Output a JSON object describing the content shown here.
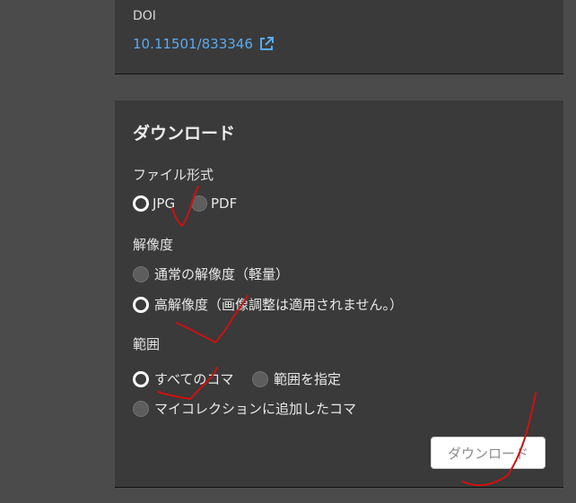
{
  "doi": {
    "label": "DOI",
    "value": "10.11501/833346",
    "link_icon": "external-link-icon"
  },
  "download": {
    "title": "ダウンロード",
    "file_format": {
      "label": "ファイル形式",
      "options": [
        "JPG",
        "PDF"
      ],
      "selected": "JPG"
    },
    "resolution": {
      "label": "解像度",
      "options": [
        "通常の解像度（軽量）",
        "高解像度（画像調整は適用されません。）"
      ],
      "selected": "高解像度（画像調整は適用されません。）"
    },
    "range": {
      "label": "範囲",
      "options": [
        "すべてのコマ",
        "範囲を指定",
        "マイコレクションに追加したコマ"
      ],
      "selected": "すべてのコマ"
    },
    "button_label": "ダウンロード"
  },
  "colors": {
    "page_background": "#4b4b4b",
    "panel_background": "#3a3a3a",
    "link": "#5aaaf0",
    "annotation_ink": "#cc1111"
  }
}
